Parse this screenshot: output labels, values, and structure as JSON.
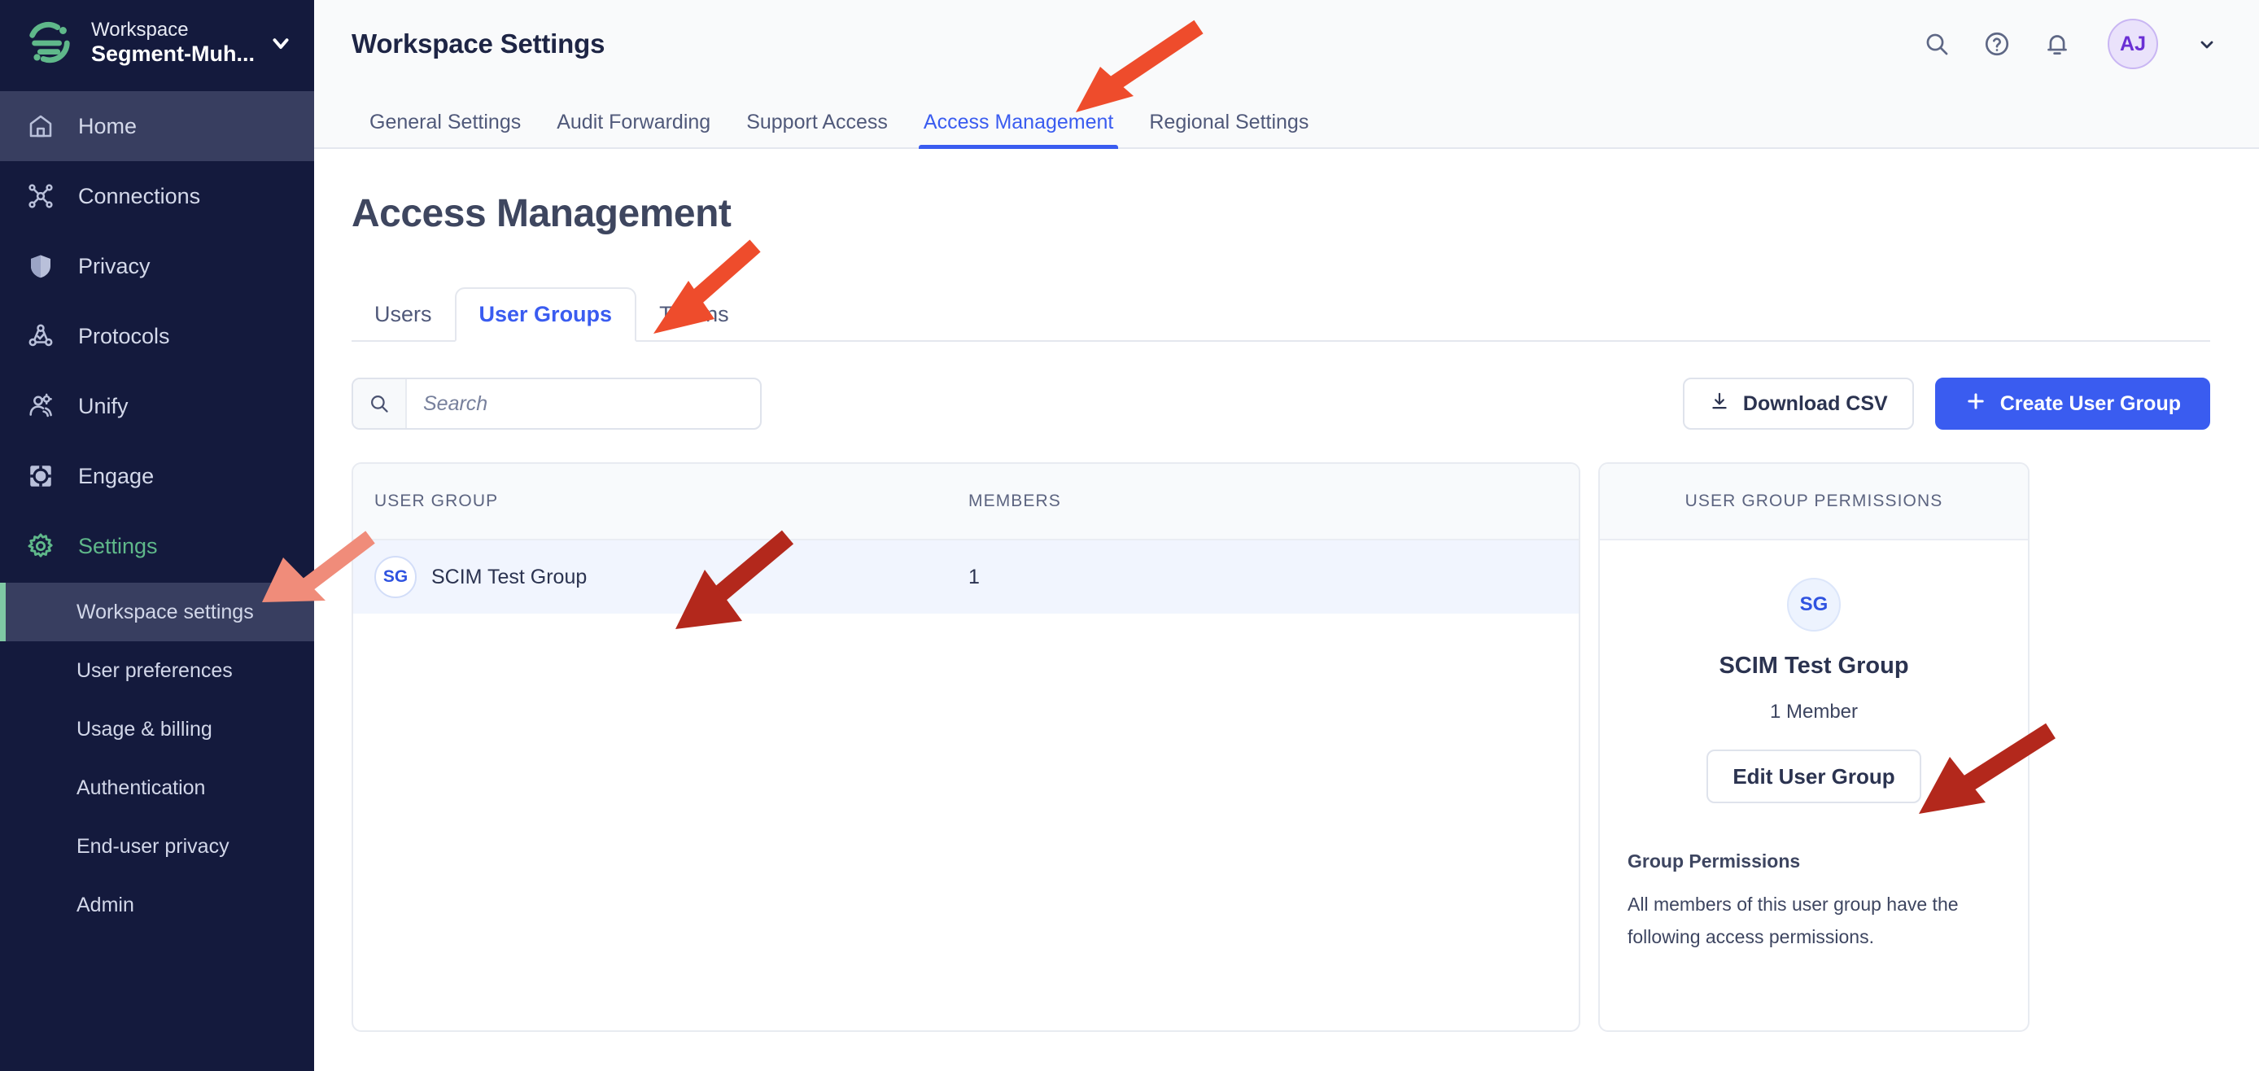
{
  "sidebar": {
    "workspace_kicker": "Workspace",
    "workspace_name": "Segment-Muh...",
    "nav": [
      {
        "label": "Home",
        "icon": "home-icon",
        "state": "hover"
      },
      {
        "label": "Connections",
        "icon": "connections-icon",
        "state": "default"
      },
      {
        "label": "Privacy",
        "icon": "shield-icon",
        "state": "default"
      },
      {
        "label": "Protocols",
        "icon": "protocols-icon",
        "state": "default"
      },
      {
        "label": "Unify",
        "icon": "unify-icon",
        "state": "default"
      },
      {
        "label": "Engage",
        "icon": "engage-icon",
        "state": "default"
      },
      {
        "label": "Settings",
        "icon": "gear-icon",
        "state": "active"
      }
    ],
    "subnav": [
      {
        "label": "Workspace settings",
        "selected": true
      },
      {
        "label": "User preferences",
        "selected": false
      },
      {
        "label": "Usage & billing",
        "selected": false
      },
      {
        "label": "Authentication",
        "selected": false
      },
      {
        "label": "End-user privacy",
        "selected": false
      },
      {
        "label": "Admin",
        "selected": false
      }
    ],
    "accent_green": "#5FB88A",
    "background": "#141A3D"
  },
  "topbar": {
    "title": "Workspace Settings",
    "icons": [
      "search-icon",
      "help-icon",
      "notification-bell-icon"
    ],
    "avatar_initials": "AJ",
    "avatar_color": "#6A2FD4"
  },
  "tabs": [
    {
      "label": "General Settings",
      "active": false
    },
    {
      "label": "Audit Forwarding",
      "active": false
    },
    {
      "label": "Support Access",
      "active": false
    },
    {
      "label": "Access Management",
      "active": true
    },
    {
      "label": "Regional Settings",
      "active": false
    }
  ],
  "page": {
    "heading": "Access Management",
    "subtabs": [
      {
        "label": "Users",
        "active": false
      },
      {
        "label": "User Groups",
        "active": true
      },
      {
        "label": "Tokens",
        "active": false
      }
    ]
  },
  "toolbar": {
    "search_placeholder": "Search",
    "search_value": "",
    "download_csv_label": "Download CSV",
    "create_group_label": "Create User Group",
    "primary_color": "#3A5CF0"
  },
  "table": {
    "columns": [
      "USER GROUP",
      "MEMBERS"
    ],
    "rows": [
      {
        "initials": "SG",
        "name": "SCIM Test Group",
        "members": "1",
        "selected": true
      }
    ]
  },
  "side_panel": {
    "header": "USER GROUP PERMISSIONS",
    "initials": "SG",
    "group_name": "SCIM Test Group",
    "member_count": "1 Member",
    "edit_button": "Edit User Group",
    "permissions_title": "Group Permissions",
    "permissions_desc": "All members of this user group have the following access permissions."
  },
  "annotations": {
    "arrow_colors": {
      "bright": "#EE4C2C",
      "salmon": "#F08C7A",
      "brick": "#B3281C"
    },
    "arrows": [
      {
        "target": "Access Management top tab",
        "color": "#EE4C2C"
      },
      {
        "target": "User Groups sub-tab",
        "color": "#EE4C2C"
      },
      {
        "target": "Workspace settings",
        "color": "#F08C7A"
      },
      {
        "target": "SCIM Test Group row",
        "color": "#B3281C"
      },
      {
        "target": "Edit User Group button",
        "color": "#B3281C"
      }
    ]
  }
}
